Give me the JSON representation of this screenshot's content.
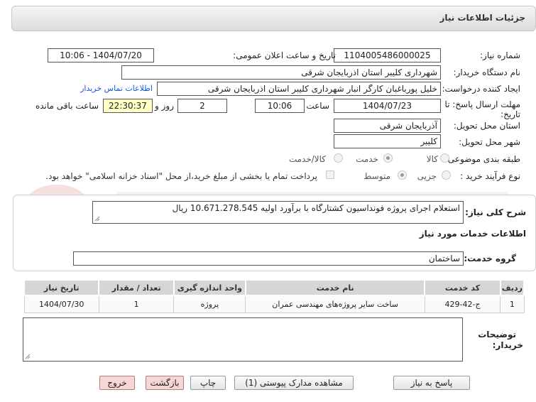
{
  "header": {
    "title": "جزئیات اطلاعات نیاز"
  },
  "labels": {
    "need_number": "شماره نیاز:",
    "announce_datetime": "تاریخ و ساعت اعلان عمومی:",
    "buyer_org": "نام دستگاه خریدار:",
    "requester": "ایجاد کننده درخواست:",
    "deadline": "مهلت ارسال پاسخ: تا",
    "deadline_date": "تاریخ:",
    "time": "ساعت",
    "day_and": "روز و",
    "time_remaining": "ساعت باقی مانده",
    "delivery_province": "استان محل تحویل:",
    "delivery_city": "شهر محل تحویل:",
    "category": "طبقه بندی موضوعی:",
    "purchase_type": "نوع فرآیند خرید :",
    "general_desc": "شرح کلی نیاز:",
    "services_info": "اطلاعات خدمات مورد نیاز",
    "service_group": "گروه خدمت:",
    "buyer_notes_1": "توضیحات",
    "buyer_notes_2": "خریدار:"
  },
  "fields": {
    "need_number": "1104005486000025",
    "announce_datetime": "1404/07/20 - 10:06",
    "buyer_org": "شهرداری کلیبر استان اذربایجان شرقی",
    "requester": "خلیل پورباغبان کارگر انبار شهرداری کلیبر استان اذربایجان شرقی",
    "contact_link": "اطلاعات تماس خریدار",
    "deadline_date": "1404/07/23",
    "deadline_time": "10:06",
    "days": "2",
    "remaining": "22:30:37",
    "province": "آذربایجان شرقی",
    "city": "کلیبر",
    "general_desc": "استعلام اجرای پروژه فونداسیون کشتارگاه با برآورد اولیه 10.671.278.545 ریال",
    "service_group": "ساختمان",
    "buyer_notes": ""
  },
  "category_options": [
    "کالا",
    "خدمت",
    "کالا/خدمت"
  ],
  "category_selected": "خدمت",
  "purchase_options": [
    "جزیی",
    "متوسط"
  ],
  "purchase_selected": "متوسط",
  "payment_note": "پرداخت تمام یا بخشی از مبلغ خرید،از محل \"اسناد خزانه اسلامی\" خواهد بود.",
  "table": {
    "headers": [
      "ردیف",
      "کد خدمت",
      "نام خدمت",
      "واحد اندازه گیری",
      "تعداد / مقدار",
      "تاریخ نیاز"
    ],
    "rows": [
      [
        "1",
        "ج-42-429",
        "ساخت سایر پروژه‌های مهندسی عمران",
        "پروژه",
        "1",
        "1404/07/30"
      ]
    ]
  },
  "buttons": {
    "reply": "پاسخ به نیاز",
    "attachments": "مشاهده مدارک پیوستی (1)",
    "print": "چاپ",
    "back": "بازگشت",
    "exit": "خروج"
  }
}
